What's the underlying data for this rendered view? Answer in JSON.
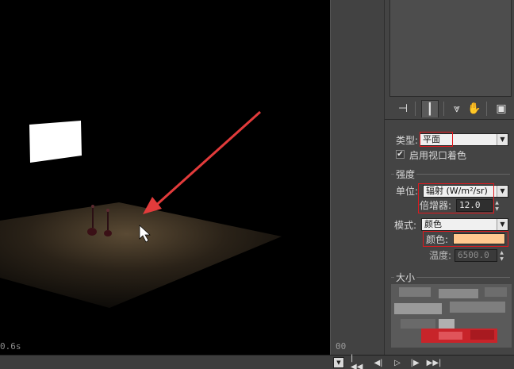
{
  "viewport": {
    "timer": "0.6s"
  },
  "timeline": {
    "tick_label": "00"
  },
  "command_panel": {
    "tabs": [
      {
        "icon": "create-icon",
        "glyph": "⊣"
      },
      {
        "icon": "modify-icon",
        "glyph": "┃"
      },
      {
        "icon": "hierarchy-icon",
        "glyph": "⩔"
      },
      {
        "icon": "motion-icon",
        "glyph": "✋"
      },
      {
        "icon": "display-icon",
        "glyph": "▣"
      }
    ],
    "type_label": "类型:",
    "type_value": "平面",
    "viewport_shading_label": "启用视口着色",
    "viewport_shading_checked": "✔",
    "intensity_group": {
      "title": "强度",
      "unit_label": "单位:",
      "unit_value": "辐射 (W/m²/sr)",
      "multiplier_label": "倍增器:",
      "multiplier_value": "12.0"
    },
    "mode_label": "模式:",
    "mode_value": "颜色",
    "color_label": "颜色:",
    "color_value": "#ffc98f",
    "temperature_label": "温度:",
    "temperature_value": "6500.0",
    "size_group": {
      "title": "大小"
    }
  },
  "playback": {
    "buttons": [
      {
        "icon": "go-to-start-icon",
        "glyph": "|◀◀"
      },
      {
        "icon": "previous-frame-icon",
        "glyph": "◀|"
      },
      {
        "icon": "play-icon",
        "glyph": "▷"
      },
      {
        "icon": "next-frame-icon",
        "glyph": "|▶"
      },
      {
        "icon": "go-to-end-icon",
        "glyph": "▶▶|"
      }
    ]
  },
  "colors": {
    "highlight_box": "#e0191e",
    "arrow": "#e23b3b",
    "light_color": "#ffc98f"
  }
}
